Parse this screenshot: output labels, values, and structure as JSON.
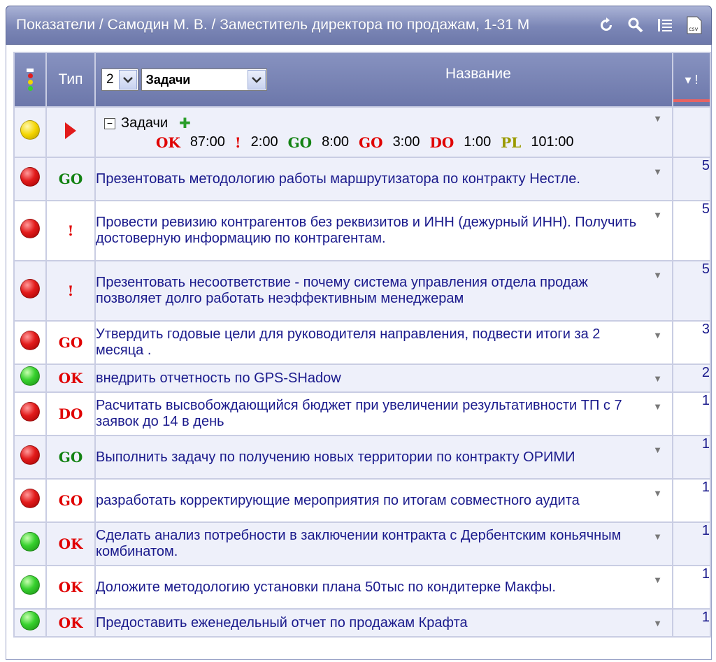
{
  "title": "Показатели / Самодин М. В. / Заместитель директора по продажам, 1-31 М",
  "icons": [
    "refresh-icon",
    "search-icon",
    "list-icon",
    "csv-icon"
  ],
  "columns": {
    "status": "",
    "type": "Тип",
    "level_value": "2",
    "group_value": "Задачи",
    "name": "Название",
    "sort": "▾ !"
  },
  "group": {
    "name": "Задачи",
    "stats": [
      {
        "key": "OK",
        "value": "87:00",
        "color": "#e00000"
      },
      {
        "key": "!",
        "value": "2:00",
        "color": "#e00000"
      },
      {
        "key": "GO",
        "value": "8:00",
        "color": "#128212"
      },
      {
        "key": "GO",
        "value": "3:00",
        "color": "#e00000"
      },
      {
        "key": "DO",
        "value": "1:00",
        "color": "#e00000"
      },
      {
        "key": "PL",
        "value": "101:00",
        "color": "#9a9a00"
      }
    ]
  },
  "rows": [
    {
      "status": "red",
      "type": "GO",
      "type_color": "green",
      "name": "Презентовать методологию работы маршрутизатора по контракту Нестле.",
      "num": "5"
    },
    {
      "status": "red",
      "type": "!",
      "type_color": "red",
      "name": "Провести ревизию контрагентов без реквизитов и ИНН (дежурный ИНН). Получить достоверную информацию по контрагентам.",
      "num": "5"
    },
    {
      "status": "red",
      "type": "!",
      "type_color": "red",
      "name": "Презентовать несоответствие - почему система управления отдела продаж позволяет долго работать неэффективным менеджерам",
      "num": "5"
    },
    {
      "status": "red",
      "type": "GO",
      "type_color": "red",
      "name": "Утвердить годовые цели для руководителя направления, подвести итоги за 2 месяца .",
      "num": "3"
    },
    {
      "status": "green",
      "type": "OK",
      "type_color": "red",
      "name": "внедрить отчетность по GPS-SHadow",
      "num": "2"
    },
    {
      "status": "red",
      "type": "DO",
      "type_color": "red",
      "name": "Расчитать высвобождающийся бюджет при увеличении результативности ТП с 7 заявок до 14 в день",
      "num": "1"
    },
    {
      "status": "red",
      "type": "GO",
      "type_color": "green",
      "name": "Выполнить задачу по получению новых территории по контракту ОРИМИ",
      "num": "1"
    },
    {
      "status": "red",
      "type": "GO",
      "type_color": "red",
      "name": "разработать корректирующие мероприятия по итогам совместного аудита",
      "num": "1"
    },
    {
      "status": "green",
      "type": "OK",
      "type_color": "red",
      "name": "Сделать анализ потребности в заключении контракта с Дербентским коньячным комбинатом.",
      "num": "1"
    },
    {
      "status": "green",
      "type": "OK",
      "type_color": "red",
      "name": "Доложите методологию установки плана 50тыс по кондитерке Макфы.",
      "num": "1"
    },
    {
      "status": "green",
      "type": "OK",
      "type_color": "red",
      "name": "Предоставить еженедельный отчет по продажам Крафта",
      "num": "1"
    }
  ]
}
